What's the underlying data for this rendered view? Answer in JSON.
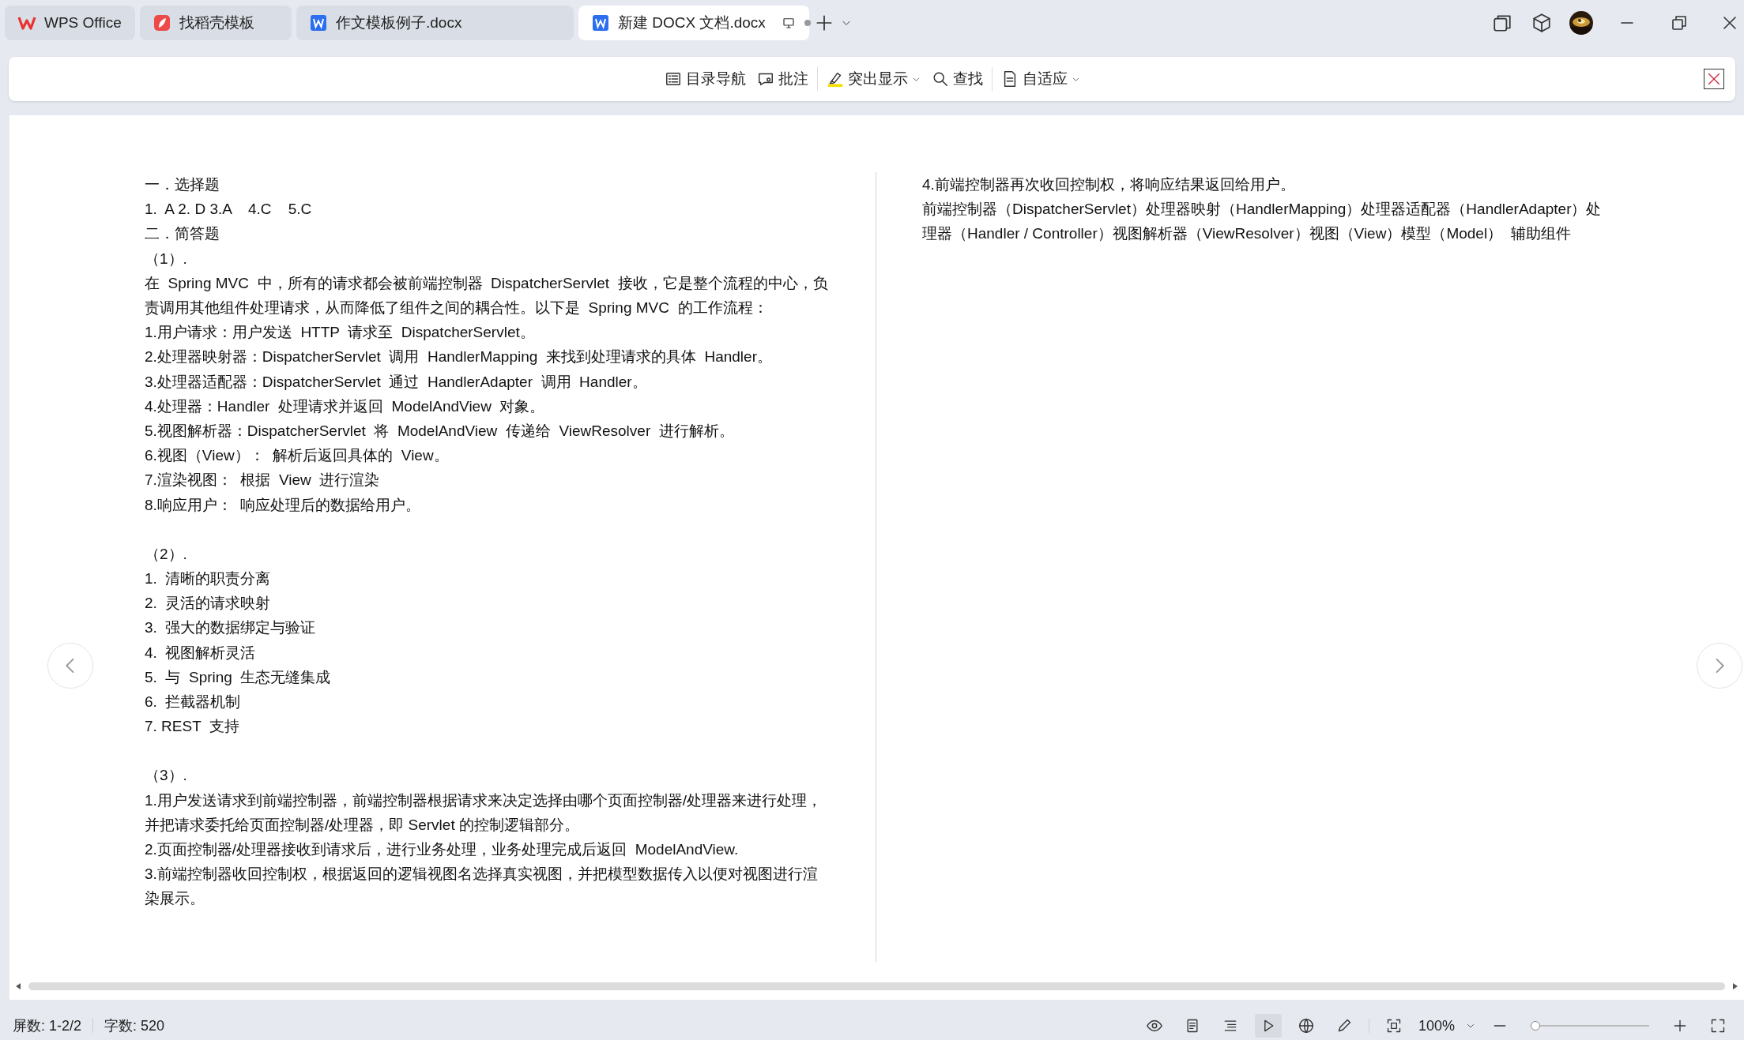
{
  "tabs": [
    {
      "label": "WPS Office",
      "kind": "home",
      "selected": false
    },
    {
      "label": "找稻壳模板",
      "kind": "template",
      "selected": false
    },
    {
      "label": "作文模板例子.docx",
      "kind": "document",
      "selected": false
    },
    {
      "label": "新建 DOCX 文档.docx",
      "kind": "document",
      "selected": true
    }
  ],
  "toolbar": [
    {
      "label": "目录导航",
      "kind": "outline",
      "dropdown": false,
      "divider_before": false
    },
    {
      "label": "批注",
      "kind": "comment",
      "dropdown": false,
      "divider_before": false
    },
    {
      "label": "突出显示",
      "kind": "highlight",
      "dropdown": true,
      "divider_before": true
    },
    {
      "label": "查找",
      "kind": "search",
      "dropdown": false,
      "divider_before": false
    },
    {
      "label": "自适应",
      "kind": "fit",
      "dropdown": true,
      "divider_before": true
    }
  ],
  "document": {
    "left_column": [
      {
        "lines": [
          "一．选择题",
          "1.  A 2. D 3.A    4.C    5.C",
          "二．简答题",
          "（1）.",
          "在  Spring MVC  中，所有的请求都会被前端控制器  DispatcherServlet  接收，它是整个流程的中心，负责调用其他组件处理请求，从而降低了组件之间的耦合性。以下是  Spring MVC  的工作流程：",
          "1.用户请求：用户发送  HTTP  请求至  DispatcherServlet。",
          "2.处理器映射器：DispatcherServlet  调用  HandlerMapping  来找到处理请求的具体  Handler。",
          "3.处理器适配器：DispatcherServlet  通过  HandlerAdapter  调用  Handler。",
          "4.处理器：Handler  处理请求并返回  ModelAndView  对象。",
          "5.视图解析器：DispatcherServlet  将  ModelAndView  传递给  ViewResolver  进行解析。",
          "6.视图（View）：  解析后返回具体的  View。",
          "7.渲染视图：  根据  View  进行渲染",
          "8.响应用户：  响应处理后的数据给用户。"
        ]
      },
      {
        "lines": [
          "（2）.",
          "1.  清晰的职责分离",
          "2.  灵活的请求映射",
          "3.  强大的数据绑定与验证",
          "4.  视图解析灵活",
          "5.  与  Spring  生态无缝集成",
          "6.  拦截器机制",
          "7. REST  支持"
        ]
      },
      {
        "lines": [
          "（3）.",
          "1.用户发送请求到前端控制器，前端控制器根据请求来决定选择由哪个页面控制器/处理器来进行处理，并把请求委托给页面控制器/处理器，即 Servlet 的控制逻辑部分。",
          "2.页面控制器/处理器接收到请求后，进行业务处理，业务处理完成后返回  ModelAndView.",
          "3.前端控制器收回控制权，根据返回的逻辑视图名选择真实视图，并把模型数据传入以便对视图进行渲染展示。"
        ]
      }
    ],
    "right_column": [
      {
        "lines": [
          "4.前端控制器再次收回控制权，将响应结果返回给用户。",
          "前端控制器（DispatcherServlet）处理器映射（HandlerMapping）处理器适配器（HandlerAdapter）处理器（Handler / Controller）视图解析器（ViewResolver）视图（View）模型（Model）  辅助组件"
        ]
      }
    ]
  },
  "status_bar": {
    "pages": "屏数: 1-2/2",
    "word_count": "字数: 520",
    "zoom": "100%",
    "zoom_level": {
      "level": 0
    }
  }
}
